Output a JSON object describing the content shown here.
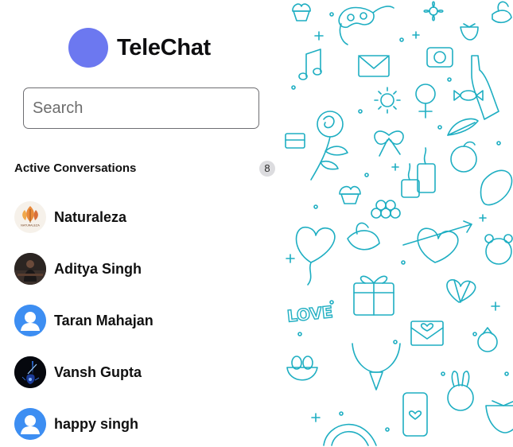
{
  "app": {
    "title": "TeleChat"
  },
  "search": {
    "placeholder": "Search",
    "value": ""
  },
  "conversations": {
    "heading": "Active Conversations",
    "count": "8",
    "items": [
      {
        "name": "Naturaleza",
        "avatar": "naturaleza-logo-avatar",
        "logo_text": "NATURALEZA"
      },
      {
        "name": "Aditya Singh",
        "avatar": "photo-avatar"
      },
      {
        "name": "Taran Mahajan",
        "avatar": "default-user-avatar"
      },
      {
        "name": "Vansh Gupta",
        "avatar": "guitar-photo-avatar"
      },
      {
        "name": "happy singh",
        "avatar": "default-user-avatar"
      }
    ]
  },
  "wallpaper": {
    "text": "LOVE",
    "pattern": "love-doodle-pattern"
  },
  "colors": {
    "brand_logo": "#6c78f0",
    "default_avatar": "#3b8ef0",
    "doodle_stroke": "#1eaec2",
    "badge_bg": "#dcdcdf"
  }
}
